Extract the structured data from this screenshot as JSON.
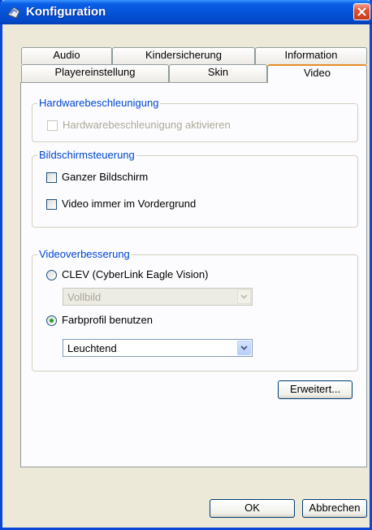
{
  "window": {
    "title": "Konfiguration",
    "title_icon": "app-icon",
    "close_icon": "close-icon"
  },
  "tabs": {
    "row1": [
      "Audio",
      "Kindersicherung",
      "Information"
    ],
    "row2": [
      "Playereinstellung",
      "Skin",
      "Video"
    ],
    "active": "Video"
  },
  "hardware": {
    "title": "Hardwarebeschleunigung",
    "enable_label": "Hardwarebeschleunigung aktivieren",
    "enabled": false
  },
  "screen": {
    "title": "Bildschirmsteuerung",
    "fullscreen_label": "Ganzer Bildschirm",
    "fullscreen": false,
    "ontop_label": "Video immer im Vordergrund",
    "ontop": false
  },
  "enhance": {
    "title": "Videoverbesserung",
    "clev_label": "CLEV (CyberLink Eagle Vision)",
    "clev_selected": false,
    "clev_value": "Vollbild",
    "profile_label": "Farbprofil benutzen",
    "profile_selected": true,
    "profile_value": "Leuchtend"
  },
  "buttons": {
    "advanced": "Erweitert...",
    "ok": "OK",
    "cancel": "Abbrechen"
  },
  "colors": {
    "titlebar": "#0553d8",
    "group_title": "#0046d5",
    "active_tab_accent": "#e68b2c",
    "radio_dot": "#21a121"
  }
}
